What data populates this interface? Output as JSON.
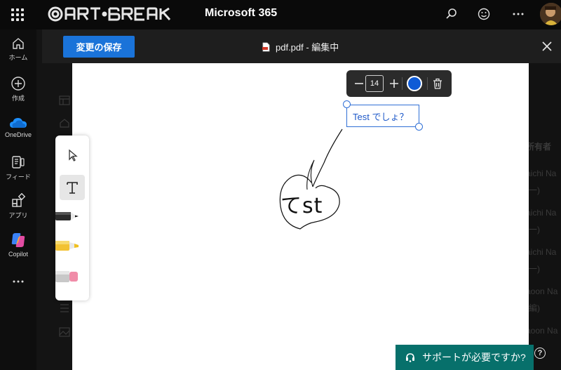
{
  "header": {
    "brand_logo_text": "ART-BREAK",
    "app_title": "Microsoft 365",
    "icons": [
      "waffle-icon",
      "search-icon",
      "smiley-icon",
      "more-icon",
      "avatar"
    ]
  },
  "nav": {
    "items": [
      {
        "label": "ホーム",
        "icon": "home-icon"
      },
      {
        "label": "作成",
        "icon": "plus-circle-icon"
      },
      {
        "label": "OneDrive",
        "icon": "onedrive-cloud-icon"
      },
      {
        "label": "フィード",
        "icon": "feed-icon"
      },
      {
        "label": "アプリ",
        "icon": "apps-icon"
      },
      {
        "label": "Copilot",
        "icon": "copilot-icon"
      }
    ],
    "more_icon": "ellipsis-icon"
  },
  "editor": {
    "save_label": "変更の保存",
    "doc_title": "pdf.pdf - 編集中",
    "close_icon": "close-icon"
  },
  "tools": [
    "select-arrow-icon",
    "text-tool-icon",
    "pen-tool-icon",
    "highlighter-tool-icon",
    "eraser-tool-icon"
  ],
  "format": {
    "font_size": "14",
    "color": "#0f5bd6"
  },
  "annotation": {
    "textbox_text": "Test でしょ？",
    "ink_text": "てst"
  },
  "help": {
    "banner_label": "サポートが必要ですか?"
  },
  "accent_colors": {
    "primary": "#1a73d9",
    "help": "#07706b"
  }
}
